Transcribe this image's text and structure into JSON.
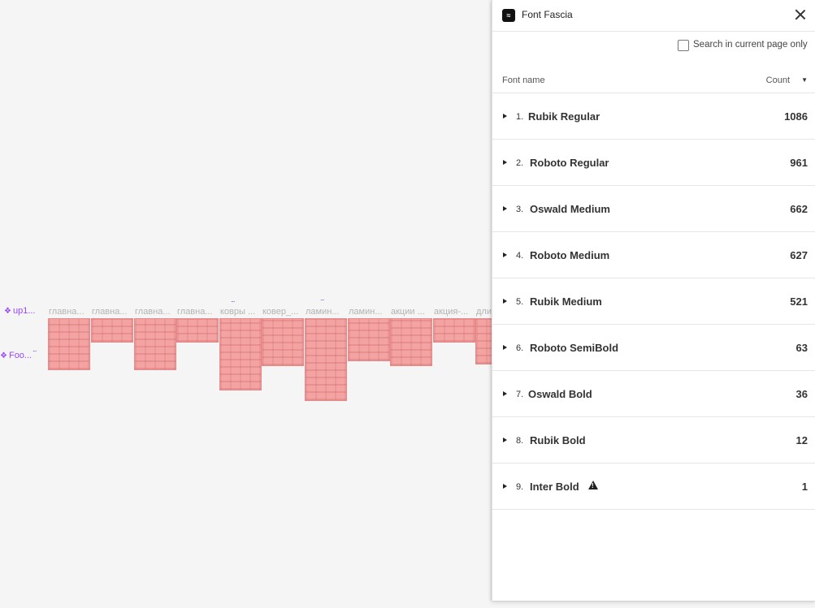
{
  "canvas": {
    "components": [
      {
        "label": "up1...",
        "dots": "..."
      },
      {
        "label": "Foo...",
        "dots": "..."
      }
    ],
    "frames": [
      "главна...",
      "главна...",
      "главна...",
      "главна...",
      "ковры ...",
      "ковер_...",
      "ламин...",
      "ламин...",
      "акции ...",
      "акция-...",
      "дли..."
    ],
    "frame_dots": "..."
  },
  "panel": {
    "logo_icon": "fascia-logo-icon",
    "title": "Font Fascia",
    "search_checkbox_label": "Search in current page only",
    "columns": {
      "name": "Font name",
      "count": "Count",
      "sort_icon": "▼"
    },
    "fonts": [
      {
        "index": "1.",
        "name": "Rubik Regular",
        "count": "1086",
        "warning": false
      },
      {
        "index": "2.",
        "name": "Roboto Regular",
        "count": "961",
        "warning": false
      },
      {
        "index": "3.",
        "name": "Oswald Medium",
        "count": "662",
        "warning": false
      },
      {
        "index": "4.",
        "name": "Roboto Medium",
        "count": "627",
        "warning": false
      },
      {
        "index": "5.",
        "name": "Rubik Medium",
        "count": "521",
        "warning": false
      },
      {
        "index": "6.",
        "name": "Roboto SemiBold",
        "count": "63",
        "warning": false
      },
      {
        "index": "7.",
        "name": "Oswald Bold",
        "count": "36",
        "warning": false
      },
      {
        "index": "8.",
        "name": "Rubik Bold",
        "count": "12",
        "warning": false
      },
      {
        "index": "9.",
        "name": "Inter Bold",
        "count": "1",
        "warning": true
      }
    ]
  }
}
